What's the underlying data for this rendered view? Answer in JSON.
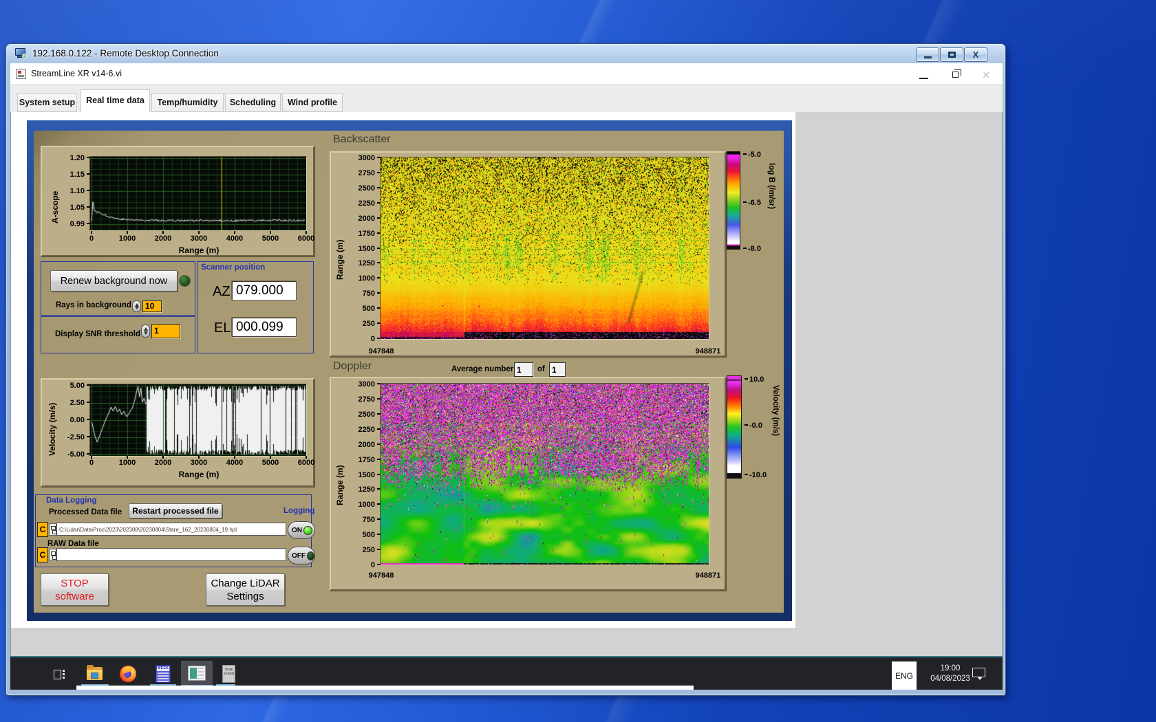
{
  "colors": {
    "accent_navy": "#16336f",
    "panel_tan": "#a89b73",
    "field_orange": "#ffb400",
    "led_on": "#46e018",
    "blue_label": "#2433b0"
  },
  "rdp_window": {
    "title": "192.168.0.122 - Remote Desktop Connection"
  },
  "app_window": {
    "title": "StreamLine XR v14-6.vi"
  },
  "tabs": [
    {
      "label": "System setup",
      "active": false
    },
    {
      "label": "Real time data",
      "active": true
    },
    {
      "label": "Temp/humidity",
      "active": false
    },
    {
      "label": "Scheduling",
      "active": false
    },
    {
      "label": "Wind profile",
      "active": false
    }
  ],
  "panel": {
    "backscatter_title": "Backscatter",
    "doppler_title": "Doppler",
    "average": {
      "label": "Average number",
      "value": "1",
      "of": "of",
      "total": "1"
    },
    "renew": {
      "button": "Renew background now",
      "rays_label": "Rays in background",
      "rays_value": "10",
      "snr_label": "Display SNR threshold",
      "snr_value": "1"
    },
    "scanner": {
      "title": "Scanner position",
      "az_label": "AZ",
      "az_value": "079.000",
      "el_label": "EL",
      "el_value": "000.099"
    },
    "logging": {
      "title": "Data Logging",
      "processed_label": "Processed Data file",
      "restart_button": "Restart processed file",
      "logging_label": "Logging",
      "drive": "C",
      "processed_path": "C:\\Lidar\\Data\\Proc\\2023\\202308\\20230804\\Stare_162_20230804_19.hpl",
      "on_label": "ON",
      "raw_label": "RAW Data file",
      "raw_path": "",
      "off_label": "OFF"
    },
    "stop_button": {
      "line1": "STOP",
      "line2": "software"
    },
    "change_button": {
      "line1": "Change LiDAR",
      "line2": "Settings"
    }
  },
  "taskbar": {
    "lang": "ENG",
    "time": "19:00",
    "date": "04/08/2023",
    "icons": [
      "task-view",
      "file-explorer",
      "firefox",
      "document-app",
      "streamline-app",
      "scan-scheduler"
    ]
  },
  "chart_data": [
    {
      "id": "ascope",
      "type": "line",
      "xlabel": "Range (m)",
      "ylabel": "A-scope",
      "xlim": [
        0,
        6000
      ],
      "xticks": [
        "0",
        "1000",
        "2000",
        "3000",
        "4000",
        "5000",
        "6000"
      ],
      "yticks": [
        "1.20",
        "1.15",
        "1.10",
        "1.05",
        "0.99"
      ],
      "ylim": [
        0.99,
        1.2
      ],
      "cursor_x": 3650,
      "grid": true,
      "series": [
        {
          "name": "a-scope",
          "points": [
            [
              0,
              1.0
            ],
            [
              40,
              1.062
            ],
            [
              90,
              1.03
            ],
            [
              200,
              1.028
            ],
            [
              350,
              1.02
            ],
            [
              550,
              1.012
            ],
            [
              800,
              1.006
            ],
            [
              1200,
              1.003
            ],
            [
              2000,
              1.002
            ],
            [
              3000,
              1.001
            ],
            [
              4000,
              1.001
            ],
            [
              5000,
              1.002
            ],
            [
              6000,
              1.001
            ]
          ],
          "noise": 0.003
        }
      ]
    },
    {
      "id": "velocity",
      "type": "line",
      "xlabel": "Range (m)",
      "ylabel": "Velocity (m/s)",
      "xlim": [
        0,
        6000
      ],
      "xticks": [
        "0",
        "1000",
        "2000",
        "3000",
        "4000",
        "5000",
        "6000"
      ],
      "yticks": [
        "5.00",
        "2.50",
        "0.00",
        "-2.50",
        "-5.00"
      ],
      "ylim": [
        -5,
        5
      ],
      "grid": true,
      "series": [
        {
          "name": "velocity",
          "points": [
            [
              0,
              -0.3
            ],
            [
              80,
              -2.2
            ],
            [
              150,
              -3.2
            ],
            [
              210,
              -2.4
            ],
            [
              300,
              -1.1
            ],
            [
              400,
              0.2
            ],
            [
              480,
              1.1
            ],
            [
              540,
              1.9
            ],
            [
              600,
              1.3
            ],
            [
              660,
              2.0
            ],
            [
              720,
              1.2
            ],
            [
              780,
              1.6
            ],
            [
              840,
              0.8
            ],
            [
              900,
              1.3
            ],
            [
              980,
              0.5
            ],
            [
              1060,
              1.1
            ],
            [
              1140,
              1.8
            ],
            [
              1200,
              2.8
            ],
            [
              1260,
              4.2
            ],
            [
              1300,
              4.9
            ],
            [
              1340,
              3.4
            ],
            [
              1380,
              4.7
            ],
            [
              1420,
              2.6
            ],
            [
              1470,
              3.2
            ],
            [
              1520,
              2.3
            ]
          ],
          "saturated_from": 1550,
          "saturated_range": [
            -5,
            5
          ]
        }
      ]
    },
    {
      "id": "backscatter",
      "type": "heatmap",
      "title": "Backscatter",
      "ylabel": "Range (m)",
      "x_range": [
        "947848",
        "948871"
      ],
      "y_range": [
        0,
        3000
      ],
      "yticks": [
        "3000",
        "2750",
        "2500",
        "2250",
        "2000",
        "1750",
        "1500",
        "1250",
        "1000",
        "750",
        "500",
        "250",
        "0"
      ],
      "colorbar": {
        "label": "log B (/m/sr)",
        "ticks": [
          "-5.0",
          "-6.5",
          "-8.0"
        ],
        "range": [
          -8,
          -5
        ]
      },
      "zones": [
        "2400-3000m: yellow with dense black/red speckle noise",
        "1000-2400m: yellow with green vertical streaks, sparse red dots",
        "250-1000m: solid yellow-orange, deepening orange downward",
        "80-250m: red/orange-red",
        "0-80m: black band with magenta/blue speckles, thicker right of seam x=675"
      ]
    },
    {
      "id": "doppler",
      "type": "heatmap",
      "title": "Doppler",
      "ylabel": "Range (m)",
      "x_range": [
        "947848",
        "948871"
      ],
      "y_range": [
        0,
        3000
      ],
      "yticks": [
        "3000",
        "2750",
        "2500",
        "2250",
        "2000",
        "1750",
        "1500",
        "1250",
        "1000",
        "750",
        "500",
        "250",
        "0"
      ],
      "colorbar": {
        "label": "Velocity (m/s)",
        "ticks": [
          "10.0",
          "-0.0",
          "-10.0"
        ],
        "range": [
          -10,
          10
        ]
      },
      "zones": [
        "2300-3000m: saturated magenta/purple noise with green/black/white speckles",
        "1400-2300m: mixed noise and coherent green patches, yellow band ~2000m",
        "0-1400m: smooth green with yellow/orange blobs",
        "bright green vertical seam line at x=675 up to ~1900m, magenta bottom line left of seam"
      ]
    }
  ]
}
